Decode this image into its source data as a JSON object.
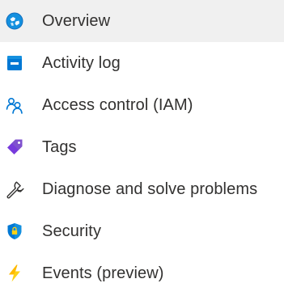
{
  "nav": {
    "items": [
      {
        "label": "Overview",
        "icon": "overview-icon",
        "selected": true
      },
      {
        "label": "Activity log",
        "icon": "activity-log-icon",
        "selected": false
      },
      {
        "label": "Access control (IAM)",
        "icon": "access-control-icon",
        "selected": false
      },
      {
        "label": "Tags",
        "icon": "tag-icon",
        "selected": false
      },
      {
        "label": "Diagnose and solve problems",
        "icon": "wrench-icon",
        "selected": false
      },
      {
        "label": "Security",
        "icon": "security-shield-icon",
        "selected": false
      },
      {
        "label": "Events (preview)",
        "icon": "lightning-icon",
        "selected": false
      }
    ]
  },
  "colors": {
    "selected_background": "#f0f0f0",
    "text": "#323130",
    "azure_blue": "#0078d4",
    "tag_purple": "#773adc",
    "event_yellow": "#fcd116"
  }
}
